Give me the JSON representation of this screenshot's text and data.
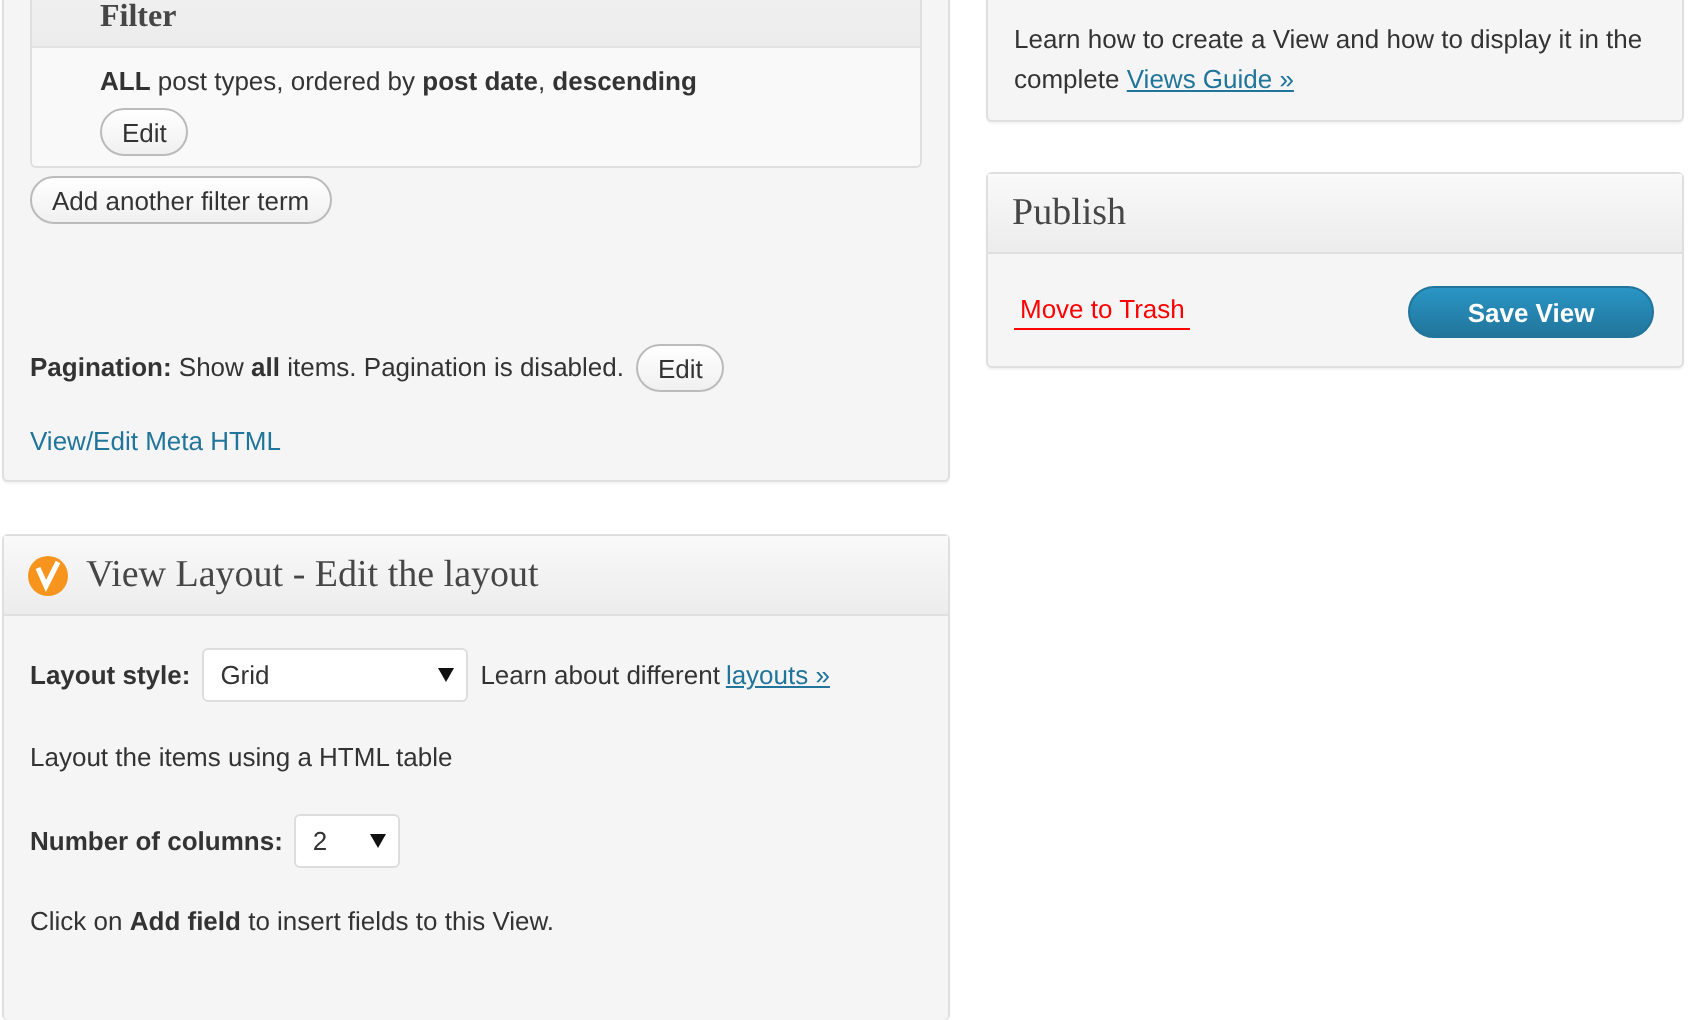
{
  "filter_box": {
    "title": "Filter",
    "summary": "**ALL** post types, ordered by **post date**, **descending**",
    "edit_button": "Edit"
  },
  "add_filter_button": "Add another filter term",
  "pagination": {
    "text": "**Pagination:** Show **all** items. Pagination is disabled.",
    "edit_button": "Edit"
  },
  "meta_html_link": "View/Edit Meta HTML",
  "layout_panel": {
    "title": "View Layout - Edit the layout",
    "layout_style": {
      "label": "Layout style:",
      "value": "Grid"
    },
    "learn_text": "Learn about different",
    "learn_link": "layouts »",
    "description": "Layout the items using a HTML table",
    "columns": {
      "label": "Number of columns:",
      "value": "2"
    },
    "hint": "Click on **Add field** to insert fields to this View."
  },
  "help_box": {
    "text": "Learn how to create a View and how to display it in the complete",
    "link": "Views Guide »"
  },
  "publish": {
    "title": "Publish",
    "trash_link": "Move to Trash",
    "save_button": "Save View"
  }
}
